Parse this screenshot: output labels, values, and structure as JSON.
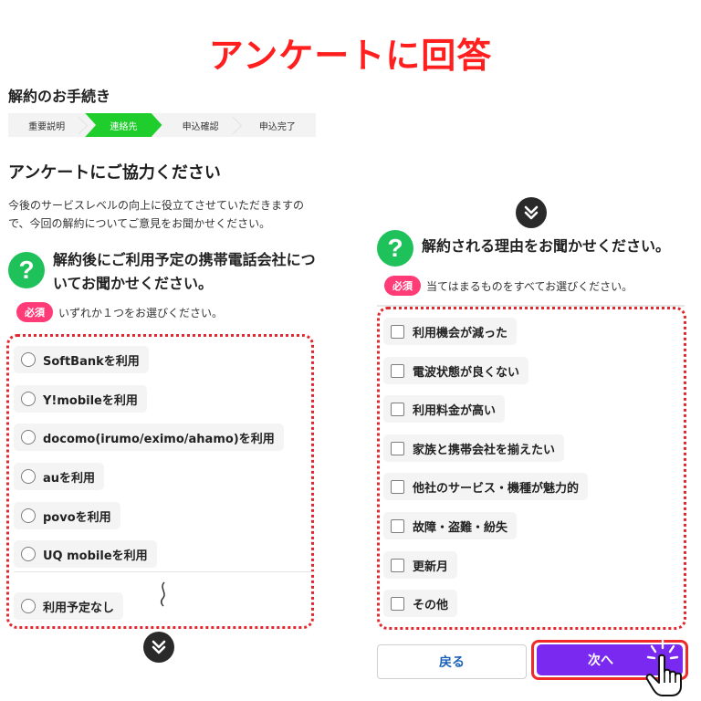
{
  "headline": "アンケートに回答",
  "procedure_title": "解約のお手続き",
  "steps": [
    {
      "label": "重要説明",
      "active": false
    },
    {
      "label": "連絡先",
      "active": true
    },
    {
      "label": "申込確認",
      "active": false
    },
    {
      "label": "申込完了",
      "active": false
    }
  ],
  "survey": {
    "title": "アンケートにご協力ください",
    "description": "今後のサービスレベルの向上に役立てさせていただきますので、今回の解約についてご意見をお聞かせください。"
  },
  "question1": {
    "icon": "question-icon",
    "text": "解約後にご利用予定の携帯電話会社についてお聞かせください。",
    "required_label": "必須",
    "hint": "いずれか１つをお選びください。",
    "options": [
      "SoftBankを利用",
      "Y!mobileを利用",
      "docomo(irumo/eximo/ahamo)を利用",
      "auを利用",
      "povoを利用",
      "UQ mobileを利用",
      "利用予定なし"
    ]
  },
  "question2": {
    "icon": "question-icon",
    "text": "解約される理由をお聞かせください。",
    "required_label": "必須",
    "hint": "当てはまるものをすべてお選びください。",
    "options": [
      "利用機会が減った",
      "電波状態が良くない",
      "利用料金が高い",
      "家族と携帯会社を揃えたい",
      "他社のサービス・機種が魅力的",
      "故障・盗難・紛失",
      "更新月",
      "その他"
    ]
  },
  "buttons": {
    "back": "戻る",
    "next": "次へ"
  },
  "colors": {
    "headline": "#ff1f1f",
    "step_active": "#1fce2d",
    "question_icon": "#1fc15a",
    "required_badge": "#ff3c78",
    "highlight": "#e2282f",
    "next_button": "#7a2af0",
    "back_text": "#1c62b9"
  }
}
